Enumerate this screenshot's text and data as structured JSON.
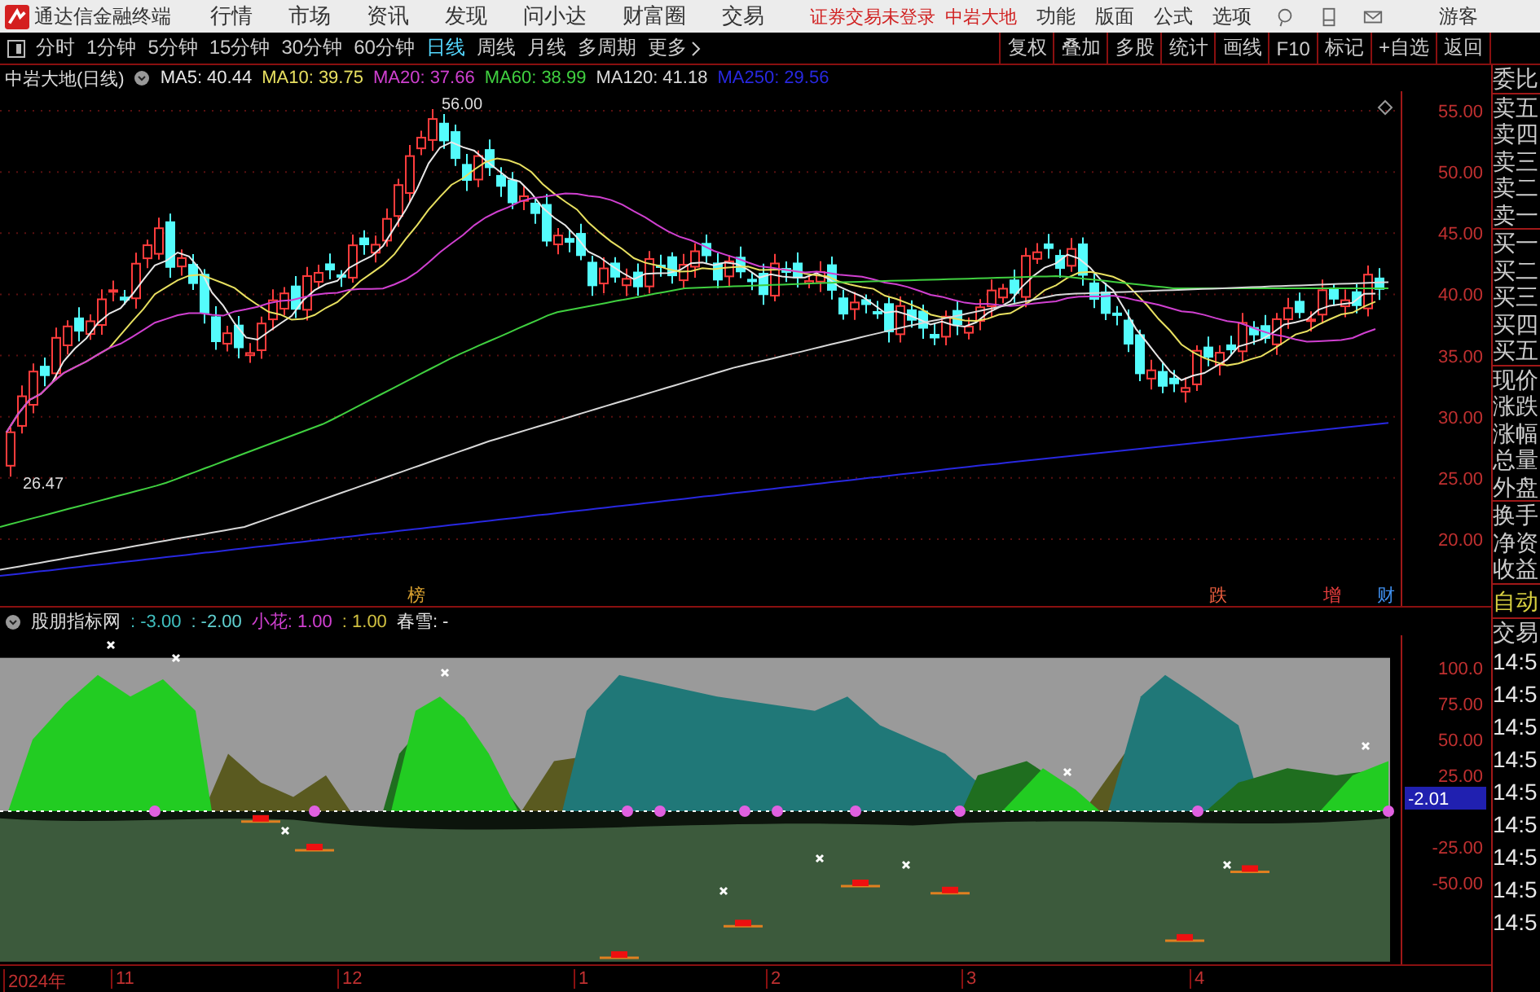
{
  "top_bar": {
    "app_title": "通达信金融终端",
    "menu": [
      "行情",
      "市场",
      "资讯",
      "发现",
      "问小达",
      "财富圈",
      "交易"
    ],
    "login_status": "证券交易未登录",
    "stock_name": "中岩大地",
    "right_menu": [
      "功能",
      "版面",
      "公式",
      "选项"
    ],
    "user": "游客"
  },
  "period_tabs": [
    {
      "label": "分时",
      "selected": false
    },
    {
      "label": "1分钟",
      "selected": false
    },
    {
      "label": "5分钟",
      "selected": false
    },
    {
      "label": "15分钟",
      "selected": false
    },
    {
      "label": "30分钟",
      "selected": false
    },
    {
      "label": "60分钟",
      "selected": false
    },
    {
      "label": "日线",
      "selected": true
    },
    {
      "label": "周线",
      "selected": false
    },
    {
      "label": "月线",
      "selected": false
    },
    {
      "label": "多周期",
      "selected": false
    },
    {
      "label": "更多",
      "selected": false
    }
  ],
  "tool_buttons": [
    "复权",
    "叠加",
    "多股",
    "统计",
    "画线",
    "F10",
    "标记",
    "+自选",
    "返回"
  ],
  "price_chart": {
    "title": "中岩大地(日线)",
    "ma_legend": [
      {
        "text": "MA5: 40.44",
        "color": "#e8e8e8"
      },
      {
        "text": "MA10: 39.75",
        "color": "#e8e060"
      },
      {
        "text": "MA20: 37.66",
        "color": "#d040d0"
      },
      {
        "text": "MA60: 38.99",
        "color": "#40d040"
      },
      {
        "text": "MA120: 41.18",
        "color": "#d8d8d8"
      },
      {
        "text": "MA250: 29.56",
        "color": "#2828e0"
      }
    ],
    "axis_labels": [
      "55.00",
      "50.00",
      "45.00",
      "40.00",
      "35.00",
      "30.00",
      "25.00",
      "20.00"
    ],
    "high_label": "56.00",
    "low_label": "26.47",
    "events": [
      {
        "text": "榜",
        "color": "#d8a030"
      },
      {
        "text": "跌",
        "color": "#f06040"
      },
      {
        "text": "增",
        "color": "#f04040"
      },
      {
        "text": "财",
        "color": "#4090f0"
      }
    ]
  },
  "indicator": {
    "name": "股朋指标网",
    "legend": [
      {
        "text": ": -3.00",
        "color": "#40c0c0"
      },
      {
        "text": ": -2.00",
        "color": "#60d0d0"
      },
      {
        "text": "小花: 1.00",
        "color": "#d040d0"
      },
      {
        "text": ": 1.00",
        "color": "#d0c040"
      },
      {
        "text": "春雪: -",
        "color": "#e8e8e8"
      }
    ],
    "axis_labels": [
      "100.0",
      "75.00",
      "50.00",
      "25.00",
      "-25.00",
      "-50.00"
    ],
    "current_value": "-2.01"
  },
  "x_axis": [
    "2024年",
    "11",
    "12",
    "1",
    "2",
    "3",
    "4"
  ],
  "quote_panel": {
    "groups": [
      [
        "委比"
      ],
      [
        "卖五",
        "卖四",
        "卖三",
        "卖二",
        "卖一"
      ],
      [
        "买一",
        "买二",
        "买三",
        "买四",
        "买五"
      ],
      [
        "现价",
        "涨跌",
        "涨幅",
        "总量",
        "外盘"
      ],
      [
        "换手",
        "净资",
        "收益"
      ]
    ],
    "mode": "自动",
    "trade": "交易",
    "times": [
      "14:5",
      "14:5",
      "14:5",
      "14:5",
      "14:5",
      "14:5",
      "14:5",
      "14:5",
      "14:5"
    ]
  }
}
